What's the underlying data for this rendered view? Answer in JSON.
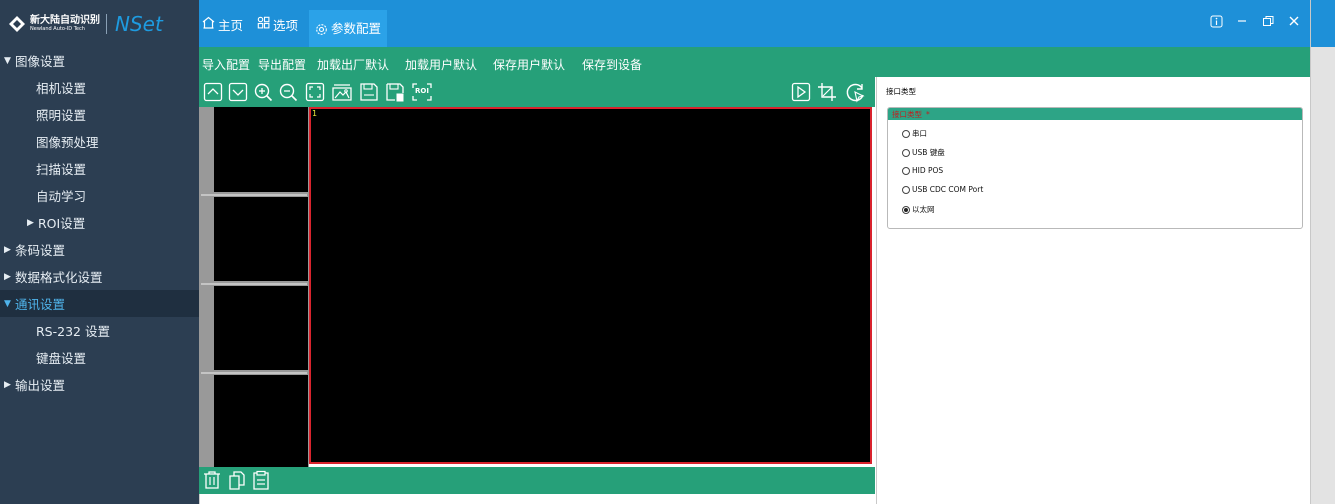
{
  "app": {
    "brand_cn": "新大陆自动识别",
    "brand_en": "Newland Auto-ID Tech",
    "name": "NSet"
  },
  "tabs": [
    {
      "label": "主页",
      "icon": "home-icon"
    },
    {
      "label": "选项",
      "icon": "options-icon"
    },
    {
      "label": "参数配置",
      "icon": "gear-icon",
      "active": true
    }
  ],
  "sidebar": {
    "items": [
      {
        "label": "图像设置",
        "level": 1,
        "expanded": true
      },
      {
        "label": "相机设置",
        "level": 2
      },
      {
        "label": "照明设置",
        "level": 2
      },
      {
        "label": "图像预处理",
        "level": 2
      },
      {
        "label": "扫描设置",
        "level": 2
      },
      {
        "label": "自动学习",
        "level": 2
      },
      {
        "label": "ROI设置",
        "level": 2,
        "expanded": false
      },
      {
        "label": "条码设置",
        "level": 1,
        "expanded": false
      },
      {
        "label": "数据格式化设置",
        "level": 1,
        "expanded": false
      },
      {
        "label": "通讯设置",
        "level": 1,
        "expanded": true,
        "active": true
      },
      {
        "label": "RS-232 设置",
        "level": 2
      },
      {
        "label": "键盘设置",
        "level": 2
      },
      {
        "label": "输出设置",
        "level": 1,
        "expanded": false
      }
    ]
  },
  "menu": {
    "import": "导入配置",
    "export": "导出配置",
    "load_factory": "加载出厂默认",
    "load_user": "加载用户默认",
    "save_user": "保存用户默认",
    "save_device": "保存到设备"
  },
  "image_tools": [
    "chevron-up-icon",
    "chevron-down-icon",
    "zoom-in-icon",
    "zoom-out-icon",
    "fit-screen-icon",
    "image-icon",
    "save-icon",
    "save-as-icon",
    "roi-icon"
  ],
  "image_tools_right": [
    "play-icon",
    "crop-icon",
    "refresh-icon"
  ],
  "roi_label": "ROI",
  "viewer": {
    "frame_number": "1"
  },
  "bottom_tools": [
    "trash-icon",
    "copy-icon",
    "clipboard-icon"
  ],
  "config": {
    "panel_title": "接口类型",
    "group_title": "接口类型",
    "required_mark": "*",
    "options": [
      {
        "label": "串口",
        "selected": false
      },
      {
        "label": "USB 键盘",
        "selected": false
      },
      {
        "label": "HID POS",
        "selected": false
      },
      {
        "label": "USB CDC COM Port",
        "selected": false
      },
      {
        "label": "以太网",
        "selected": true
      }
    ]
  },
  "colors": {
    "sidebar": "#2c3e52",
    "topbar": "#1e90d8",
    "toolbar": "#26a079",
    "active_text": "#4fb3ea",
    "view_border": "#d9232d"
  }
}
